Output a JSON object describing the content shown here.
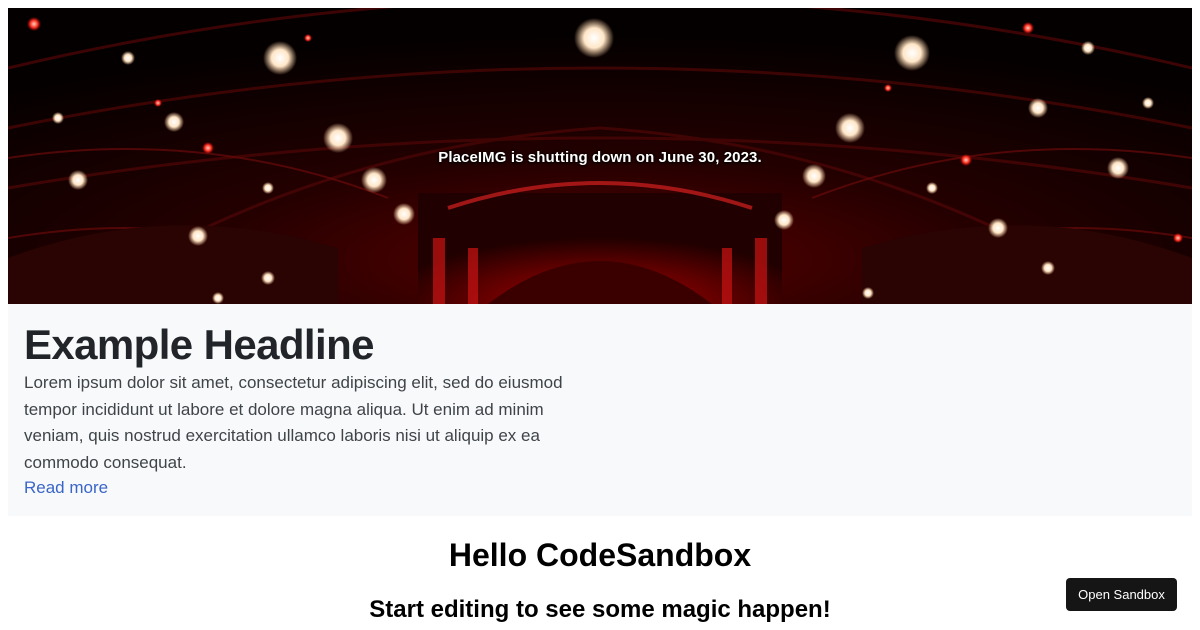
{
  "hero": {
    "caption": "PlaceIMG is shutting down on June 30, 2023."
  },
  "card": {
    "headline": "Example Headline",
    "body": "Lorem ipsum dolor sit amet, consectetur adipiscing elit, sed do eiusmod tempor incididunt ut labore et dolore magna aliqua. Ut enim ad minim veniam, quis nostrud exercitation ullamco laboris nisi ut aliquip ex ea commodo consequat.",
    "link_label": "Read more"
  },
  "app": {
    "title": "Hello CodeSandbox",
    "subtitle": "Start editing to see some magic happen!"
  },
  "sandbox_button": {
    "label": "Open Sandbox"
  },
  "colors": {
    "card_background": "#f8f9fa",
    "link": "#3a66c8",
    "button_background": "#151515",
    "hero_accent": "#8a0000"
  }
}
